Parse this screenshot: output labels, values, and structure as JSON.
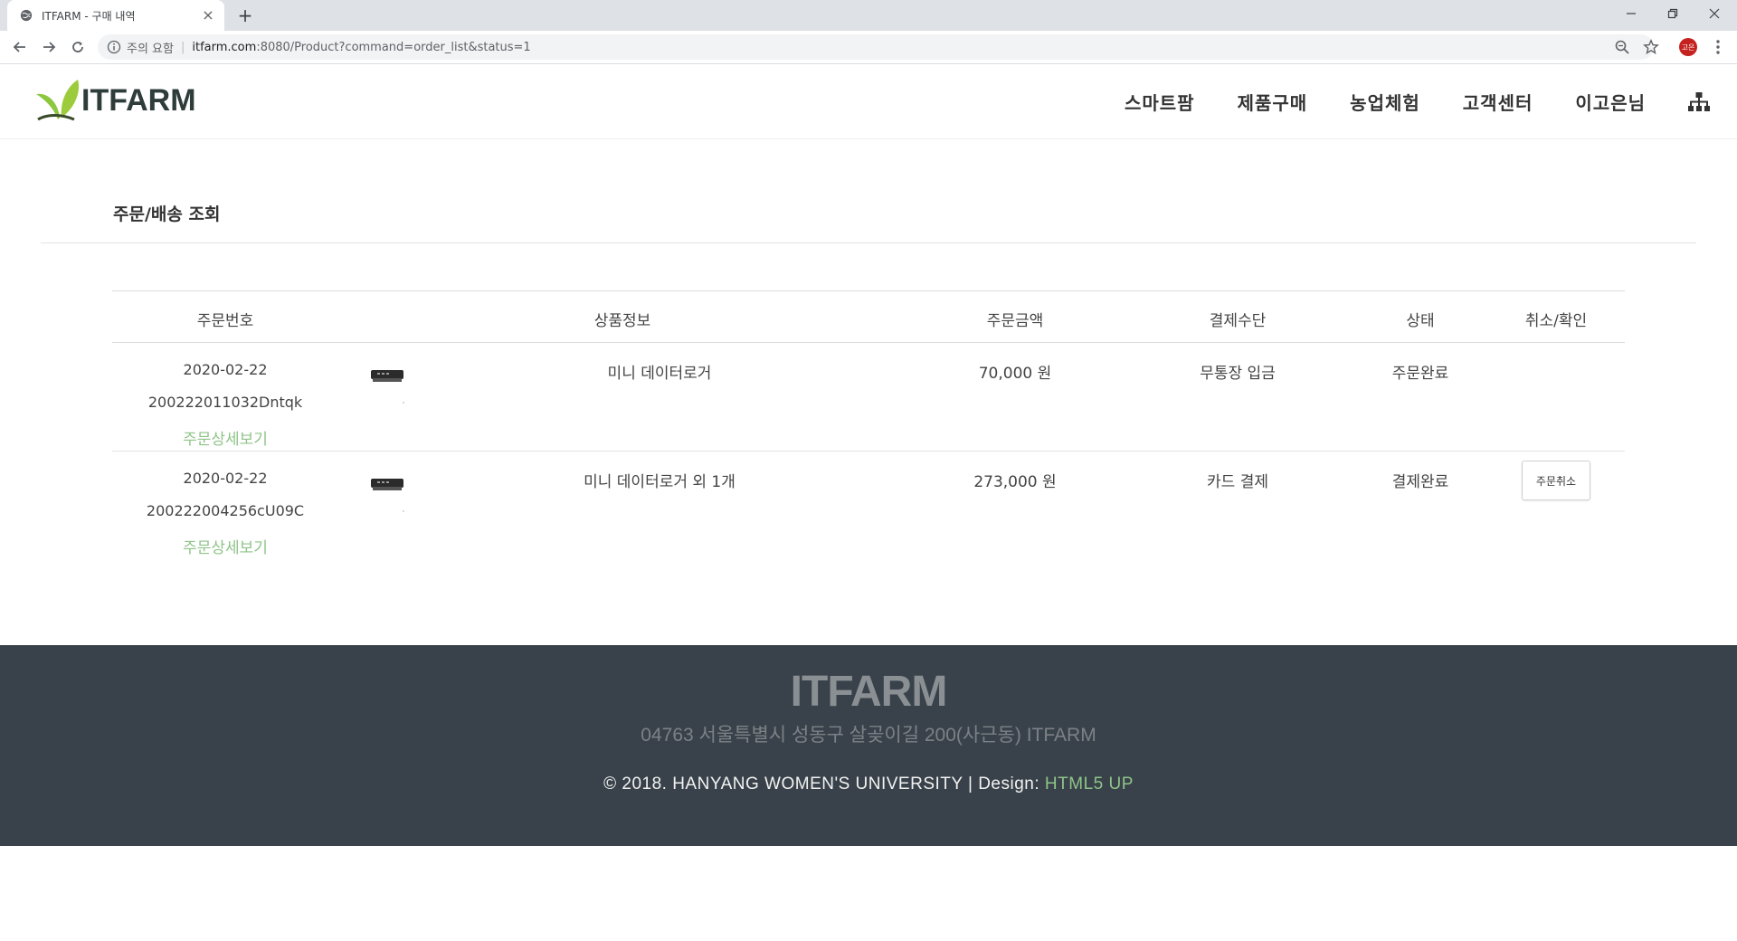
{
  "browser": {
    "tab_title": "ITFARM - 구매 내역",
    "tab_close": "×",
    "new_tab": "+",
    "security_label": "주의 요함",
    "url_host": "itfarm.com",
    "url_rest": ":8080/Product?command=order_list&status=1",
    "profile_initials": "고은"
  },
  "header": {
    "logo_text": "ITFARM",
    "nav": [
      "스마트팜",
      "제품구매",
      "농업체험",
      "고객센터",
      "이고은님"
    ]
  },
  "page": {
    "title": "주문/배송 조회"
  },
  "orders": {
    "columns": [
      "주문번호",
      "상품정보",
      "주문금액",
      "결제수단",
      "상태",
      "취소/확인"
    ],
    "rows": [
      {
        "date": "2020-02-22",
        "order_no": "200222011032Dntqk",
        "detail_link": "주문상세보기",
        "product": "미니 데이터로거",
        "amount": "70,000 원",
        "payment": "무통장 입금",
        "status": "주문완료",
        "action": ""
      },
      {
        "date": "2020-02-22",
        "order_no": "200222004256cU09C",
        "detail_link": "주문상세보기",
        "product": "미니 데이터로거 외 1개",
        "amount": "273,000 원",
        "payment": "카드 결제",
        "status": "결제완료",
        "action": "주문취소"
      }
    ]
  },
  "footer": {
    "logo_text": "ITFARM",
    "address": "04763 서울특별시 성동구 살곶이길 200(사근동) ITFARM",
    "copyright": "© 2018. HANYANG WOMEN'S UNIVERSITY | Design: ",
    "credit_link": "HTML5 UP"
  },
  "colors": {
    "accent_green": "#8fc488",
    "footer_bg": "#39424a",
    "logo_leaf": "#8dc63f"
  }
}
